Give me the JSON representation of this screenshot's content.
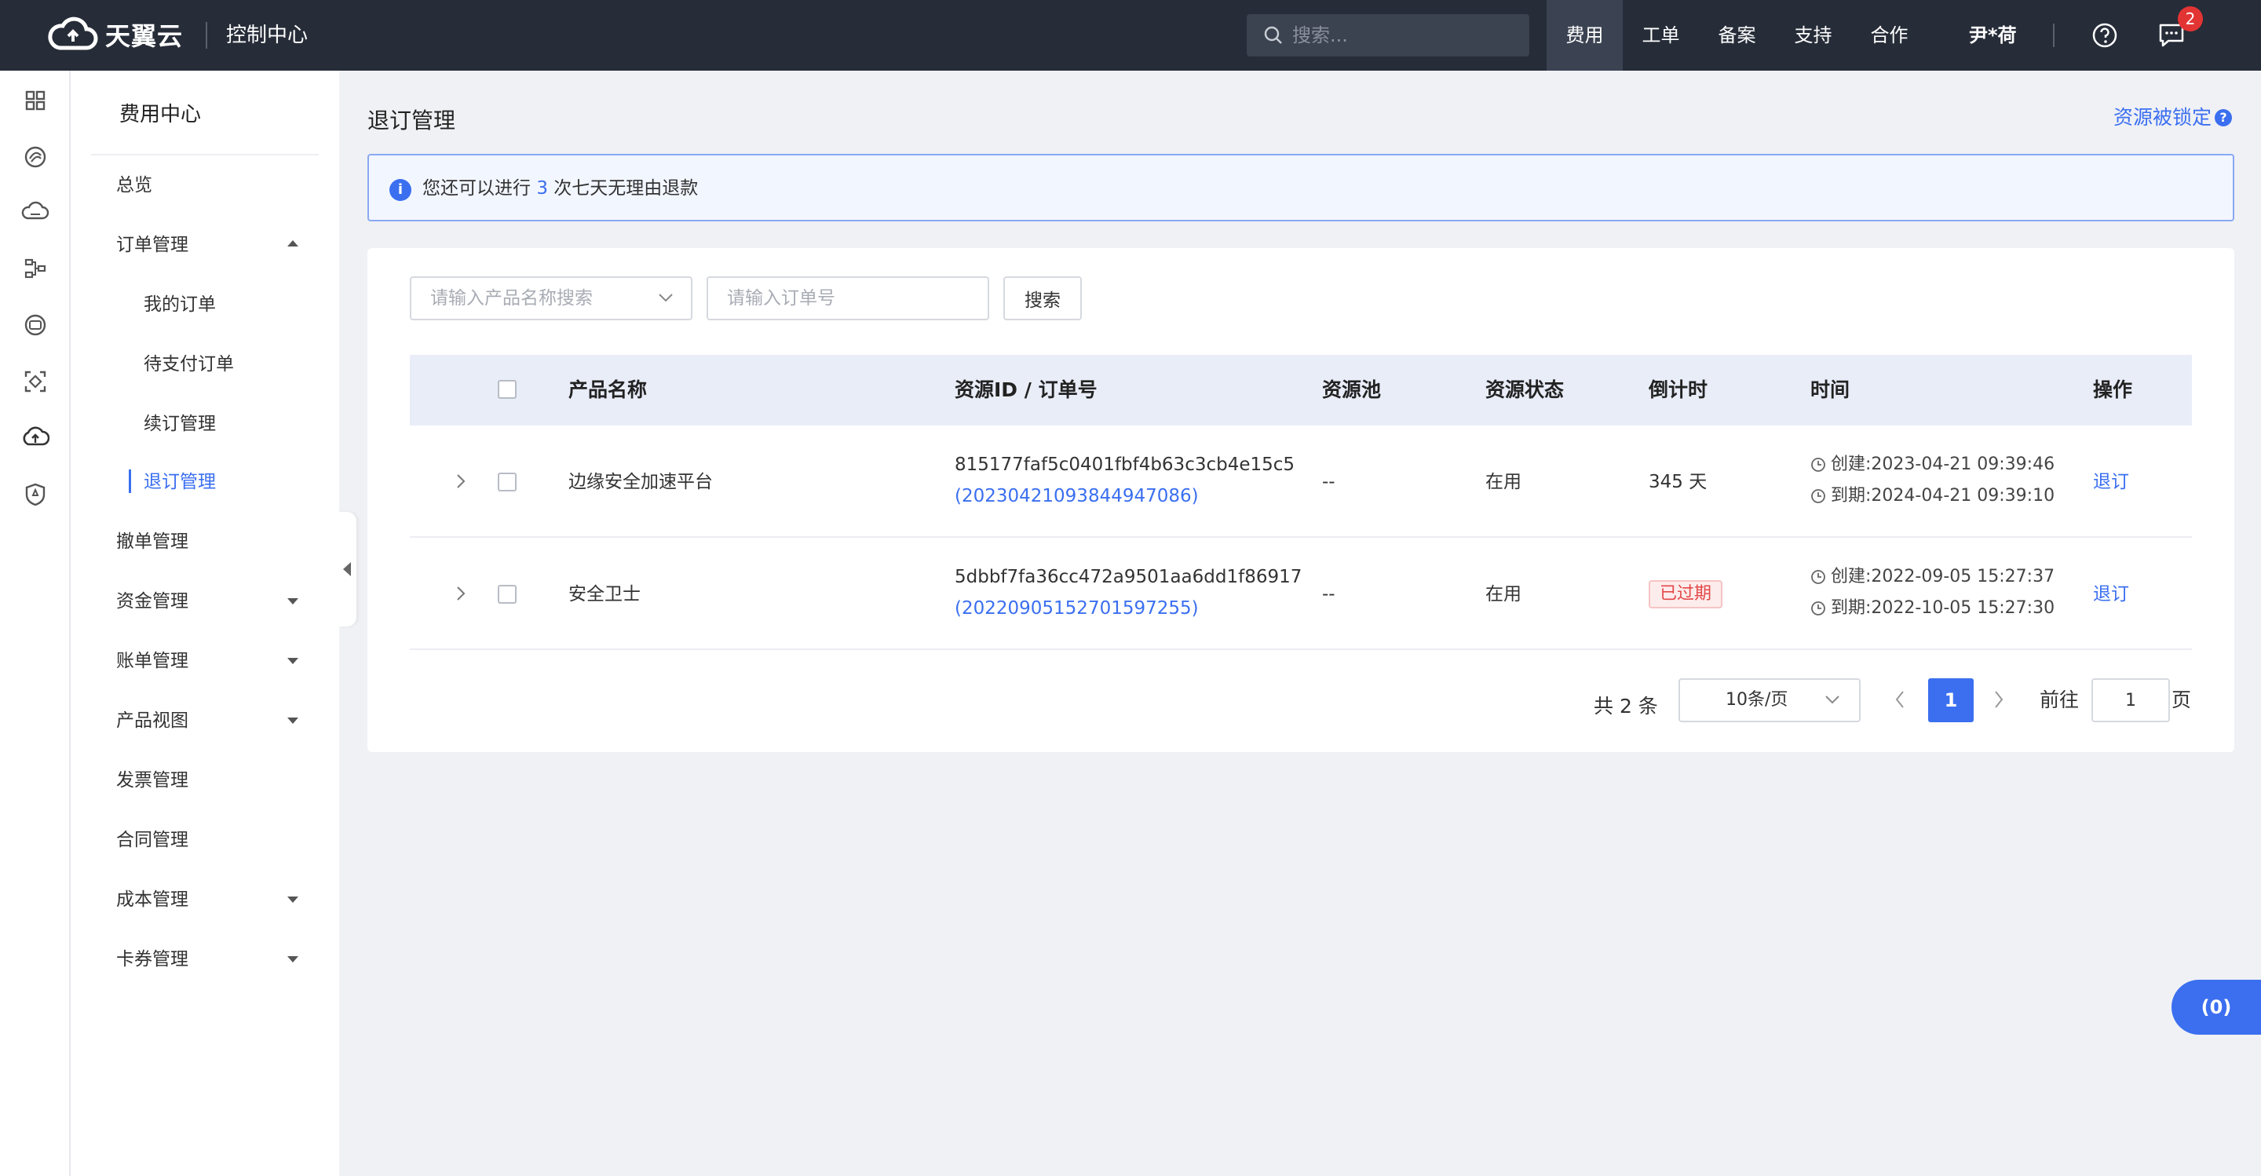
{
  "brand": {
    "logo_text": "天翼云",
    "console": "控制中心"
  },
  "topbar": {
    "search_placeholder": "搜索...",
    "nav": [
      "费用",
      "工单",
      "备案",
      "支持",
      "合作"
    ],
    "active_nav": "费用",
    "user": "尹*荷",
    "messages_count": "2"
  },
  "sidebar": {
    "title": "费用中心",
    "items": [
      {
        "label": "总览"
      },
      {
        "label": "订单管理"
      },
      {
        "label": "我的订单"
      },
      {
        "label": "待支付订单"
      },
      {
        "label": "续订管理"
      },
      {
        "label": "退订管理"
      },
      {
        "label": "撤单管理"
      },
      {
        "label": "资金管理"
      },
      {
        "label": "账单管理"
      },
      {
        "label": "产品视图"
      },
      {
        "label": "发票管理"
      },
      {
        "label": "合同管理"
      },
      {
        "label": "成本管理"
      },
      {
        "label": "卡券管理"
      }
    ]
  },
  "main": {
    "title": "退订管理",
    "locked_link": "资源被锁定",
    "notice": {
      "prefix": "您还可以进行",
      "count": "3",
      "suffix": "次七天无理由退款"
    },
    "filters": {
      "product_placeholder": "请输入产品名称搜索",
      "order_placeholder": "请输入订单号",
      "search_label": "搜索"
    },
    "table": {
      "columns": [
        "产品名称",
        "资源ID / 订单号",
        "资源池",
        "资源状态",
        "倒计时",
        "时间",
        "操作"
      ],
      "rows": [
        {
          "product": "边缘安全加速平台",
          "resource_id": "815177faf5c0401fbf4b63c3cb4e15c5",
          "order_no": "(20230421093844947086)",
          "pool": "--",
          "status": "在用",
          "countdown": "345 天",
          "created": "创建:2023-04-21 09:39:46",
          "expires": "到期:2024-04-21 09:39:10",
          "action": "退订"
        },
        {
          "product": "安全卫士",
          "resource_id": "5dbbf7fa36cc472a9501aa6dd1f86917",
          "order_no": "(20220905152701597255)",
          "pool": "--",
          "status": "在用",
          "countdown": "已过期",
          "created": "创建:2022-09-05 15:27:37",
          "expires": "到期:2022-10-05 15:27:30",
          "action": "退订"
        }
      ]
    },
    "pagination": {
      "total": "共 2 条",
      "page_size": "10条/页",
      "current": "1",
      "goto_label": "前往",
      "goto_value": "1",
      "page_unit": "页"
    }
  },
  "float_button": "(0)",
  "colors": {
    "topbar": "#262c38",
    "accent": "#3b6ff0",
    "expired": "#e34848"
  }
}
